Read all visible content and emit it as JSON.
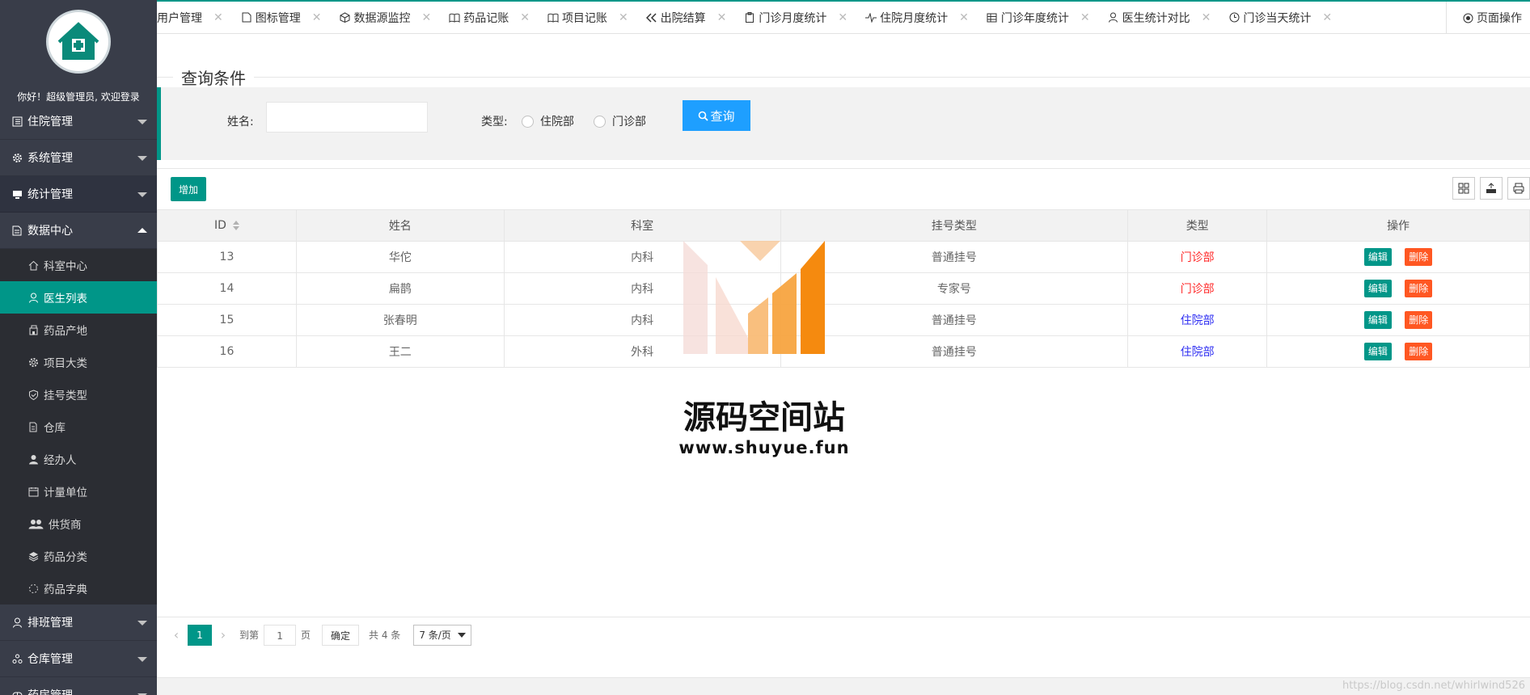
{
  "sidebar": {
    "welcome": "你好！超级管理员, 欢迎登录",
    "groups_top": [
      {
        "label": "住院管理",
        "icon": "list-icon"
      },
      {
        "label": "系统管理",
        "icon": "gear-icon"
      },
      {
        "label": "统计管理",
        "icon": "monitor-icon"
      }
    ],
    "data_center": {
      "label": "数据中心",
      "icon": "document-icon"
    },
    "sub_items": [
      {
        "label": "科室中心",
        "icon": "home-icon"
      },
      {
        "label": "医生列表",
        "icon": "user-icon"
      },
      {
        "label": "药品产地",
        "icon": "building-icon"
      },
      {
        "label": "项目大类",
        "icon": "gear-icon"
      },
      {
        "label": "挂号类型",
        "icon": "shield-icon"
      },
      {
        "label": "仓库",
        "icon": "file-icon"
      },
      {
        "label": "经办人",
        "icon": "person-icon"
      },
      {
        "label": "计量单位",
        "icon": "calendar-icon"
      },
      {
        "label": "供货商",
        "icon": "users-icon"
      },
      {
        "label": "药品分类",
        "icon": "layers-icon"
      },
      {
        "label": "药品字典",
        "icon": "loading-icon"
      }
    ],
    "groups_bottom": [
      {
        "label": "排班管理",
        "icon": "user-icon"
      },
      {
        "label": "仓库管理",
        "icon": "cluster-icon"
      },
      {
        "label": "药房管理",
        "icon": "pill-icon"
      }
    ]
  },
  "tabs": [
    {
      "label": "用户管理",
      "icon": ""
    },
    {
      "label": "图标管理",
      "icon": "note-icon"
    },
    {
      "label": "数据源监控",
      "icon": "cube-icon"
    },
    {
      "label": "药品记账",
      "icon": "book-icon"
    },
    {
      "label": "项目记账",
      "icon": "book-icon"
    },
    {
      "label": "出院结算",
      "icon": "double-left-icon"
    },
    {
      "label": "门诊月度统计",
      "icon": "clipboard-icon"
    },
    {
      "label": "住院月度统计",
      "icon": "pulse-icon"
    },
    {
      "label": "门诊年度统计",
      "icon": "table-icon"
    },
    {
      "label": "医生统计对比",
      "icon": "user-icon"
    },
    {
      "label": "门诊当天统计",
      "icon": "clock-icon"
    }
  ],
  "page_op": "页面操作",
  "query": {
    "legend": "查询条件",
    "name_label": "姓名:",
    "name_value": "",
    "type_label": "类型:",
    "radio1": "住院部",
    "radio2": "门诊部",
    "search_btn": "查询"
  },
  "add_btn": "增加",
  "table": {
    "headers": [
      "ID",
      "姓名",
      "科室",
      "挂号类型",
      "类型",
      "操作"
    ],
    "rows": [
      {
        "id": "13",
        "name": "华佗",
        "dept": "内科",
        "reg": "普通挂号",
        "type": "门诊部",
        "type_color": "red"
      },
      {
        "id": "14",
        "name": "扁鹊",
        "dept": "内科",
        "reg": "专家号",
        "type": "门诊部",
        "type_color": "red"
      },
      {
        "id": "15",
        "name": "张春明",
        "dept": "内科",
        "reg": "普通挂号",
        "type": "住院部",
        "type_color": "blue"
      },
      {
        "id": "16",
        "name": "王二",
        "dept": "外科",
        "reg": "普通挂号",
        "type": "住院部",
        "type_color": "blue"
      }
    ],
    "edit": "编辑",
    "delete": "删除"
  },
  "pager": {
    "current": "1",
    "goto": "到第",
    "page_input": "1",
    "page_unit": "页",
    "confirm": "确定",
    "total": "共 4 条",
    "per_page": "7 条/页"
  },
  "watermark": {
    "title": "源码空间站",
    "url": "www.shuyue.fun"
  },
  "corner_url": "https://blog.csdn.net/whirlwind526",
  "colors": {
    "accent": "#009688",
    "sidebar": "#393d49",
    "search_btn": "#1e9fff",
    "delete_btn": "#ff5722"
  }
}
